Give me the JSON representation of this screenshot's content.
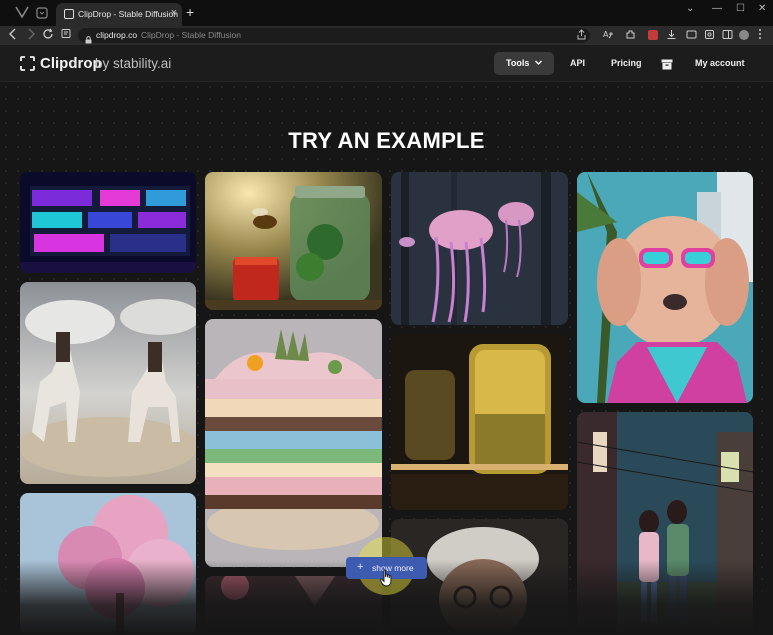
{
  "browser": {
    "tab_title": "ClipDrop - Stable Diffusion",
    "tab_close": "×",
    "new_tab": "+",
    "window_controls": [
      "⌄",
      "—",
      "☐",
      "✕"
    ],
    "url_host": "clipdrop.co",
    "url_page_title": "ClipDrop - Stable Diffusion"
  },
  "header": {
    "brand": "Clipdrop",
    "brand_suffix": "by stability.ai",
    "nav": {
      "tools": "Tools",
      "api": "API",
      "pricing": "Pricing",
      "account": "My account"
    }
  },
  "main": {
    "heading": "TRY AN EXAMPLE",
    "show_more": "show more",
    "show_more_icon": "+"
  },
  "gallery": [
    {
      "id": "cyberpunk-building"
    },
    {
      "id": "bee-jar"
    },
    {
      "id": "jellyfish-forest"
    },
    {
      "id": "dog-sunglasses"
    },
    {
      "id": "cowboys-horses"
    },
    {
      "id": "layered-cake"
    },
    {
      "id": "train-window"
    },
    {
      "id": "anime-street"
    },
    {
      "id": "cherry-blossom"
    },
    {
      "id": "old-man-portrait"
    },
    {
      "id": "partial-card"
    }
  ],
  "colors": {
    "accent_button": "#3d5bb0",
    "cursor_highlight": "#ebe63c"
  }
}
